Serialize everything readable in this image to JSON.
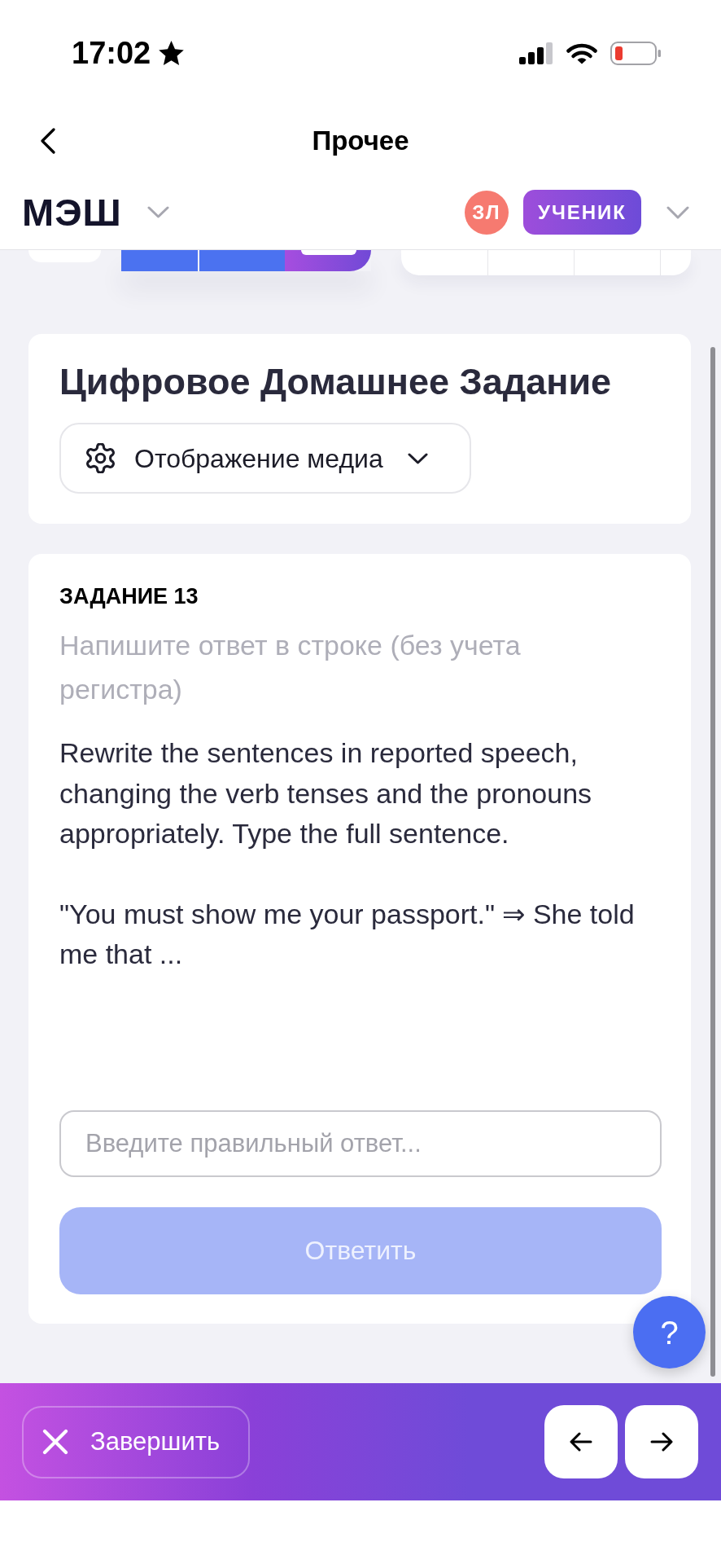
{
  "status_bar": {
    "time": "17:02"
  },
  "nav_bar": {
    "title": "Прочее"
  },
  "header": {
    "logo": "МЭШ",
    "avatar_initials": "ЗЛ",
    "role_badge": "УЧЕНИК"
  },
  "page_header": {
    "title": "Цифровое Домашнее Задание",
    "media_dropdown": {
      "label": "Отображение медиа",
      "expanded": false
    }
  },
  "task": {
    "number_label": "ЗАДАНИЕ 13",
    "instruction": "Напишите ответ в строке (без учета регистра)",
    "prompt": [
      "Rewrite the sentences in reported speech, changing the verb tenses and the pronouns appropriately. Type the full sentence.",
      "\"You must show me your passport.\" ⇒ She told me that ..."
    ],
    "answer_field": {
      "placeholder": "Введите правильный ответ..."
    },
    "submit_button": {
      "label": "Ответить",
      "disabled": true
    }
  },
  "help_button": {
    "label": "?"
  },
  "bottom_bar": {
    "finish_button": {
      "label": "Завершить"
    }
  }
}
